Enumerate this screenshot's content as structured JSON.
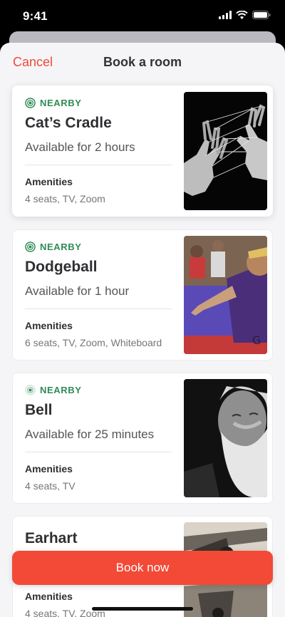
{
  "status_bar": {
    "time": "9:41"
  },
  "nav": {
    "cancel_label": "Cancel",
    "title": "Book a room"
  },
  "rooms": [
    {
      "badge": "NEARBY",
      "name": "Cat’s Cradle",
      "availability": "Available for 2 hours",
      "amenities_label": "Amenities",
      "amenities": "4 seats, TV, Zoom"
    },
    {
      "badge": "NEARBY",
      "name": "Dodgeball",
      "availability": "Available for 1 hour",
      "amenities_label": "Amenities",
      "amenities": "6 seats, TV, Zoom, Whiteboard"
    },
    {
      "badge": "NEARBY",
      "name": "Bell",
      "availability": "Available for 25 minutes",
      "amenities_label": "Amenities",
      "amenities": "4 seats, TV"
    },
    {
      "name": "Earhart",
      "amenities_label": "Amenities",
      "amenities": "4 seats, TV, Zoom"
    }
  ],
  "book_button": {
    "label": "Book now"
  },
  "colors": {
    "accent": "#f24a37",
    "nearby": "#2e8b55",
    "background": "#f5f5f7"
  },
  "icons": [
    "signal-icon",
    "wifi-icon",
    "battery-icon",
    "nearby-radar-icon"
  ]
}
